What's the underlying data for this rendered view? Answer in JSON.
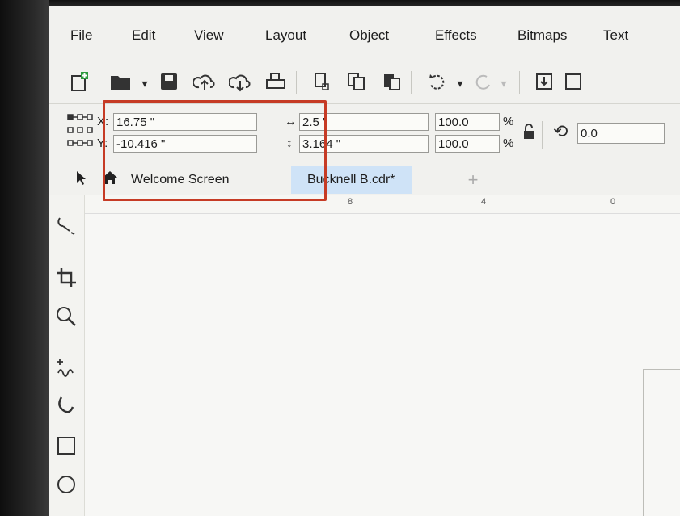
{
  "menu": [
    {
      "label": "File"
    },
    {
      "label": "Edit"
    },
    {
      "label": "View"
    },
    {
      "label": "Layout"
    },
    {
      "label": "Object"
    },
    {
      "label": "Effects"
    },
    {
      "label": "Bitmaps"
    },
    {
      "label": "Text"
    }
  ],
  "toolbar_icons": [
    "new-document",
    "open",
    "save",
    "upload-cloud",
    "upload-cloud",
    "print",
    "import",
    "copy",
    "paste",
    "undo",
    "redo",
    "export"
  ],
  "propbar": {
    "x_label": "X:",
    "x_value": "16.75 \"",
    "y_label": "Y:",
    "y_value": "-10.416 \"",
    "width_value": "2.5 \"",
    "height_value": "3.164 \"",
    "scale_x": "100.0",
    "scale_y": "100.0",
    "percent": "%",
    "rotation": "0.0"
  },
  "tabs": {
    "welcome": "Welcome Screen",
    "document": "Bucknell B.cdr*",
    "add": "+"
  },
  "ruler": {
    "labels": [
      "8",
      "4",
      "0"
    ]
  },
  "colors": {
    "highlight": "#c63b25",
    "tab_active": "#cfe3f7",
    "tab_underline": "#3a8fd6"
  }
}
